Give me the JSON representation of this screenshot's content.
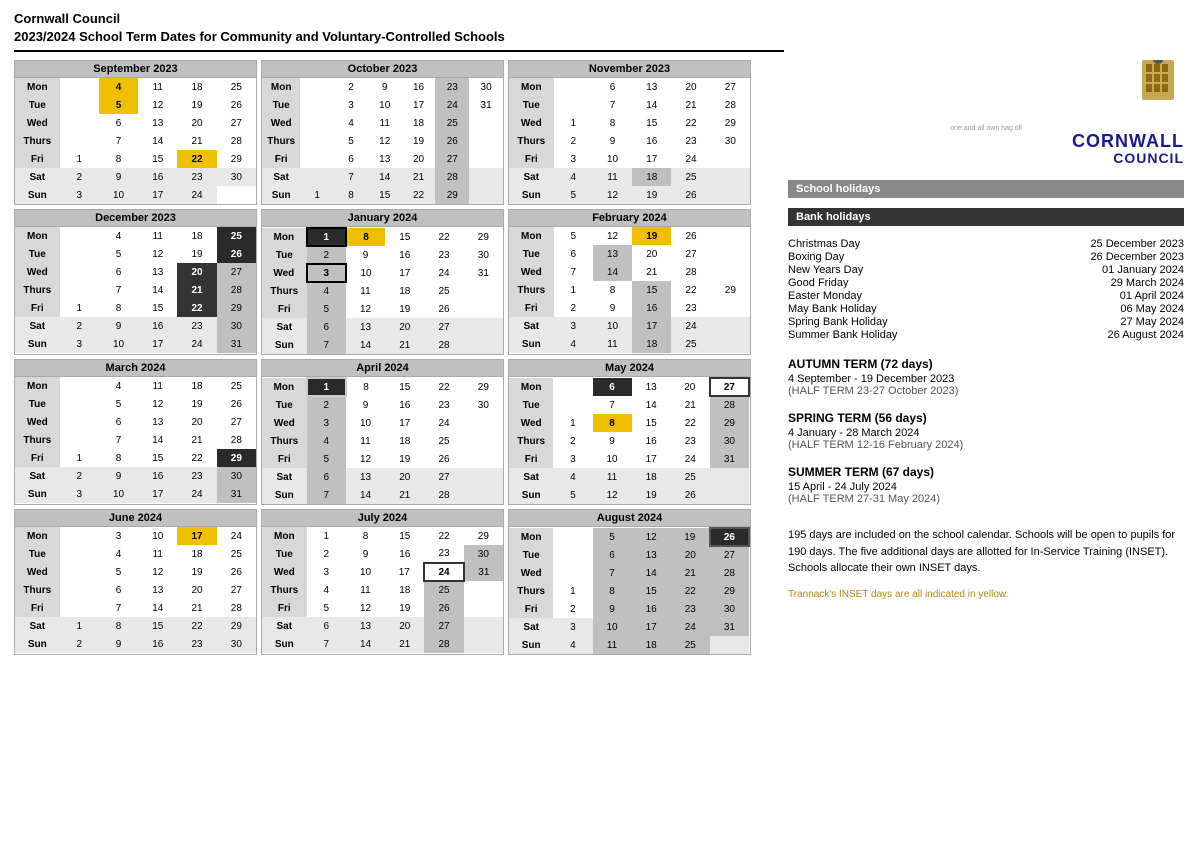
{
  "header": {
    "org": "Cornwall Council",
    "title": "2023/2024 School Term Dates for Community and Voluntary-Controlled Schools"
  },
  "logo": {
    "one_all": "one and all   own hag oll",
    "name1": "CORNWALL",
    "name2": "COUNCIL"
  },
  "legend": {
    "school_holidays": "School holidays",
    "bank_holidays": "Bank holidays"
  },
  "bank_holidays": [
    {
      "name": "Christmas Day",
      "date": "25 December 2023"
    },
    {
      "name": "Boxing Day",
      "date": "26 December 2023"
    },
    {
      "name": "New Years Day",
      "date": "01 January 2024"
    },
    {
      "name": "Good Friday",
      "date": "29 March 2024"
    },
    {
      "name": "Easter Monday",
      "date": "01 April 2024"
    },
    {
      "name": "May Bank Holiday",
      "date": "06 May 2024"
    },
    {
      "name": "Spring Bank Holiday",
      "date": "27 May 2024"
    },
    {
      "name": "Summer Bank Holiday",
      "date": "26 August 2024"
    }
  ],
  "terms": [
    {
      "title": "AUTUMN TERM  (72 days)",
      "dates": "4 September - 19 December 2023",
      "half": "(HALF TERM 23-27 October 2023)"
    },
    {
      "title": "SPRING TERM (56 days)",
      "dates": "4 January - 28 March 2024",
      "half": "(HALF TERM 12-16 February 2024)"
    },
    {
      "title": "SUMMER TERM (67 days)",
      "dates": "15 April - 24 July 2024",
      "half": "(HALF TERM 27-31 May 2024)"
    }
  ],
  "info": "195 days are included on the school calendar. Schools will be open to pupils for 190 days. The five additional days are allotted for In-Service Training (INSET). Schools allocate their own INSET days.",
  "inset_note": "Trannack's INSET days are all indicated in yellow."
}
